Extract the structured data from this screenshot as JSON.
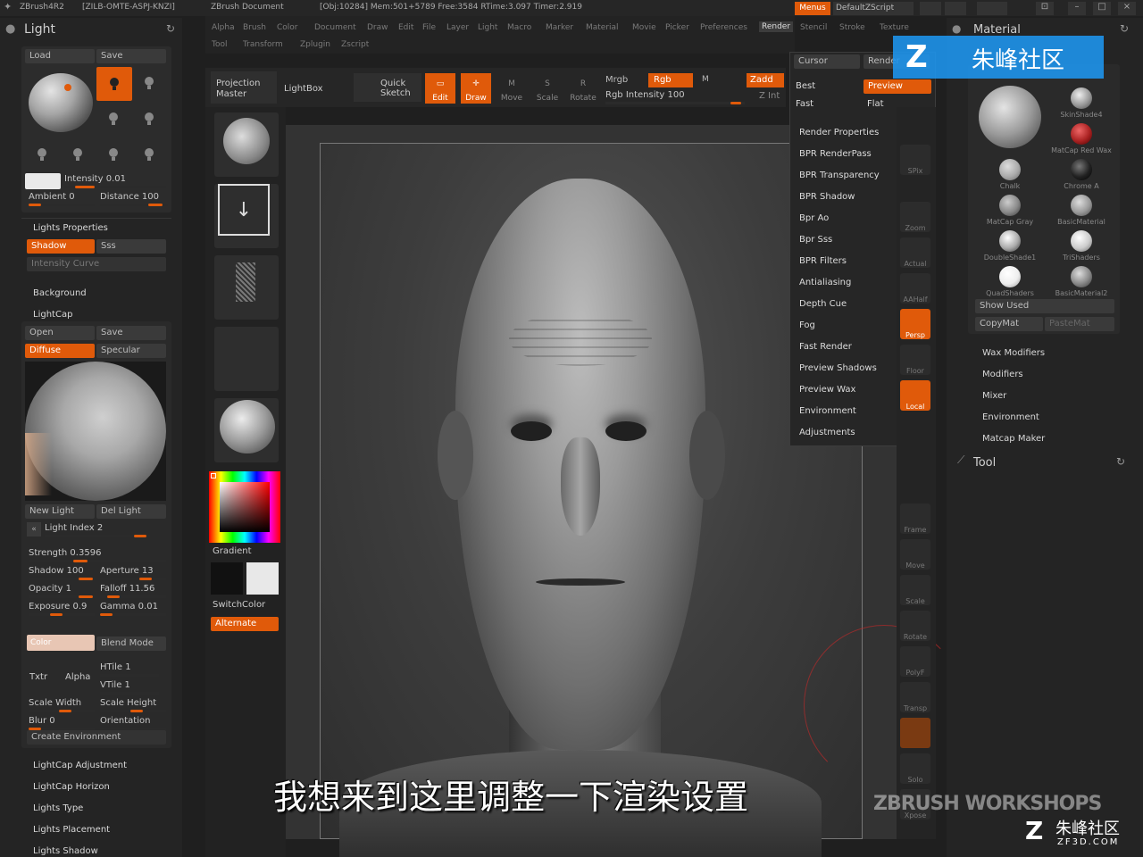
{
  "titlebar": {
    "app": "ZBrush4R2",
    "serial": "[ZILB-OMTE-ASPJ-KNZI]",
    "document": "ZBrush Document",
    "stats": "[Obj:10284] Mem:501+5789 Free:3584 RTime:3.097 Timer:2.919",
    "menus_btn": "Menus",
    "script": "DefaultZScript"
  },
  "menubar": {
    "row1": [
      "Alpha",
      "Brush",
      "Color",
      "Document",
      "Draw",
      "Edit",
      "File",
      "Layer",
      "Light",
      "Macro",
      "Marker",
      "Material",
      "Movie",
      "Picker",
      "Preferences",
      "Render",
      "Stencil",
      "Stroke",
      "Texture"
    ],
    "row2": [
      "Tool",
      "Transform",
      "Zplugin",
      "Zscript"
    ],
    "active": "Render"
  },
  "light_panel": {
    "title": "Light",
    "load": "Load",
    "save": "Save",
    "intensity": "Intensity 0.01",
    "ambient": "Ambient 0",
    "distance": "Distance 100",
    "lights_properties": "Lights Properties",
    "shadow": "Shadow",
    "sss": "Sss",
    "intensity_curve": "Intensity Curve",
    "background": "Background",
    "lightcap": "LightCap",
    "open": "Open",
    "save2": "Save",
    "diffuse": "Diffuse",
    "specular": "Specular",
    "new_light": "New Light",
    "del_light": "Del Light",
    "light_index": "Light Index 2",
    "strength": "Strength 0.3596",
    "shadow_val": "Shadow 100",
    "aperture": "Aperture 13",
    "opacity": "Opacity 1",
    "falloff": "Falloff 11.56",
    "exposure": "Exposure 0.9",
    "gamma": "Gamma 0.01",
    "color": "Color",
    "blend_mode": "Blend Mode",
    "htile": "HTile 1",
    "vtile": "VTile 1",
    "txtr": "Txtr",
    "alpha": "Alpha",
    "scale_width": "Scale Width",
    "scale_height": "Scale Height",
    "blur": "Blur 0",
    "orientation": "Orientation",
    "create_environment": "Create Environment",
    "sections": [
      "LightCap Adjustment",
      "LightCap Horizon",
      "Lights Type",
      "Lights Placement",
      "Lights Shadow"
    ]
  },
  "shelf": {
    "projection_master": "Projection Master",
    "lightbox": "LightBox",
    "quick_sketch": "Quick Sketch",
    "edit": "Edit",
    "draw": "Draw",
    "move": "Move",
    "scale": "Scale",
    "rotate": "Rotate",
    "mrgb": "Mrgb",
    "rgb": "Rgb",
    "m": "M",
    "rgb_intensity": "Rgb Intensity 100",
    "zadd": "Zadd",
    "zint": "Z Int"
  },
  "left_tray": {
    "gradient": "Gradient",
    "switchcolor": "SwitchColor",
    "alternate": "Alternate"
  },
  "render_menu": {
    "cursor": "Cursor",
    "render_btn": "Render",
    "best": "Best",
    "preview": "Preview",
    "fast": "Fast",
    "flat": "Flat",
    "items": [
      "Render Properties",
      "BPR RenderPass",
      "BPR Transparency",
      "BPR Shadow",
      "Bpr Ao",
      "Bpr Sss",
      "BPR Filters",
      "Antialiasing",
      "Depth Cue",
      "Fog",
      "Fast Render",
      "Preview Shadows",
      "Preview Wax",
      "Environment",
      "Adjustments"
    ]
  },
  "right_tools": [
    "SPix",
    "Zoom",
    "Actual",
    "AAHalf",
    "Persp",
    "Floor",
    "Local",
    "Frame",
    "Move",
    "Scale",
    "Rotate",
    "PolyF",
    "Transp",
    "Solo",
    "Xpose"
  ],
  "material_panel": {
    "title": "Material",
    "materials": [
      "SkinShade4",
      "MatCap Red Wax",
      "Chalk",
      "Chrome A",
      "MatCap Gray",
      "BasicMaterial",
      "DoubleShade1",
      "TriShaders",
      "QuadShaders",
      "BasicMaterial2"
    ],
    "show_used": "Show Used",
    "copymat": "CopyMat",
    "pastemat": "PasteMat",
    "sections": [
      "Wax Modifiers",
      "Modifiers",
      "Mixer",
      "Environment",
      "Matcap Maker"
    ],
    "tool": "Tool"
  },
  "watermark": {
    "brand": "朱峰社区",
    "site": "ZF3D.COM",
    "workshops": "ZBRUSH WORKSHOPS"
  },
  "subtitle": "我想来到这里调整一下渲染设置",
  "colors": {
    "accent": "#e05a0a",
    "panel": "#2a2a2a",
    "bg": "#1f1f1f"
  }
}
